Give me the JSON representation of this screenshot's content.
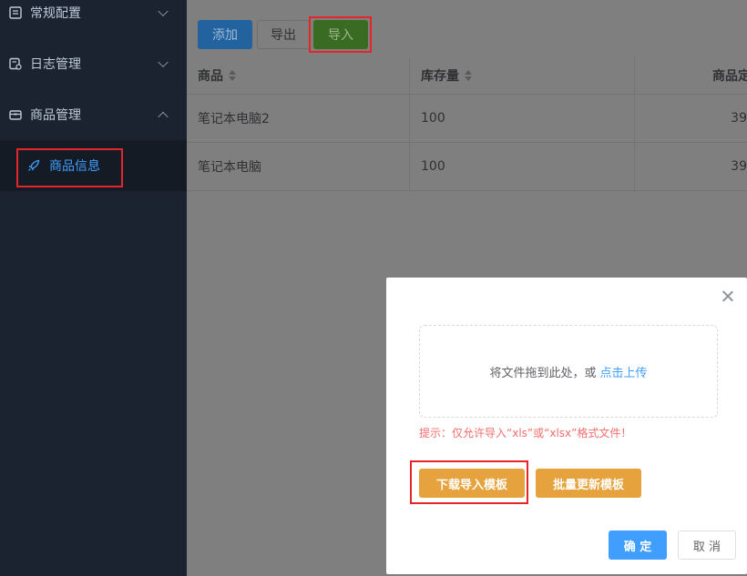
{
  "sidebar": {
    "items": [
      {
        "label": "常规配置",
        "icon": "list-icon",
        "expanded": false
      },
      {
        "label": "日志管理",
        "icon": "log-icon",
        "expanded": false
      },
      {
        "label": "商品管理",
        "icon": "box-icon",
        "expanded": true
      }
    ],
    "sub_items": [
      {
        "label": "商品信息",
        "icon": "rocket-icon",
        "active": true
      }
    ]
  },
  "toolbar": {
    "add_label": "添加",
    "export_label": "导出",
    "import_label": "导入"
  },
  "table": {
    "columns": [
      "商品",
      "库存量",
      "商品定"
    ],
    "rows": [
      {
        "name": "笔记本电脑2",
        "stock": "100",
        "price": "39"
      },
      {
        "name": "笔记本电脑",
        "stock": "100",
        "price": "39"
      }
    ]
  },
  "dialog": {
    "upload_text": "将文件拖到此处，或",
    "upload_link": "点击上传",
    "tip": "提示：仅允许导入“xls”或“xlsx”格式文件！",
    "download_template_label": "下载导入模板",
    "batch_update_template_label": "批量更新模板",
    "confirm_label": "确 定",
    "cancel_label": "取 消"
  },
  "colors": {
    "sidebar_bg": "#1b2330",
    "active_menu": "#409eff",
    "highlight_box": "#e6252b",
    "warning_button": "#e6a23c",
    "primary_button": "#409eff",
    "tip_text": "#f56c6c"
  }
}
